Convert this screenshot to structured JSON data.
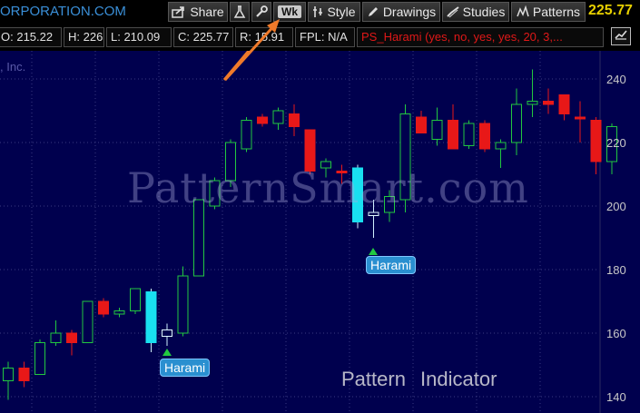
{
  "toolbar": {
    "corp_title": "ORPORATION.COM",
    "share_label": "Share",
    "wk_label": "Wk",
    "style_label": "Style",
    "drawings_label": "Drawings",
    "studies_label": "Studies",
    "patterns_label": "Patterns",
    "last_price": "225.77",
    "icons": [
      "share-icon",
      "flask-icon",
      "wrench-icon",
      "style-icon",
      "pencil-icon",
      "studies-icon",
      "patterns-icon"
    ]
  },
  "ohlc": {
    "open": "O: 215.22",
    "high": "H: 226",
    "low": "L: 210.09",
    "close": "C: 225.77",
    "range": "R: 15.91",
    "fpl": "FPL: N/A",
    "study": "PS_Harami (yes, no, yes, yes, 20, 3,..."
  },
  "chart": {
    "company_label": ", Inc.",
    "watermark": "PatternSmart.com",
    "pattern_indicator": "Pattern  Indicator",
    "annotations": [
      "Harami",
      "Harami"
    ],
    "colors": {
      "background": "#00004e",
      "up_candle": "#22c840",
      "down_candle": "#e81818",
      "harami_candle": "#19e0f0",
      "arrow_annotation": "#f07a2a"
    }
  },
  "chart_data": {
    "type": "candlestick",
    "y_axis_labels": [
      "240",
      "220",
      "200",
      "180",
      "160",
      "140"
    ],
    "ylim": [
      137,
      247
    ],
    "grid": true,
    "candles": [
      {
        "o": 145,
        "h": 151,
        "l": 139,
        "c": 149,
        "dir": "up"
      },
      {
        "o": 149,
        "h": 151,
        "l": 143,
        "c": 145,
        "dir": "down"
      },
      {
        "o": 147,
        "h": 158,
        "l": 147,
        "c": 157,
        "dir": "up"
      },
      {
        "o": 157,
        "h": 164,
        "l": 156,
        "c": 160,
        "dir": "up"
      },
      {
        "o": 160,
        "h": 161,
        "l": 153,
        "c": 157,
        "dir": "down"
      },
      {
        "o": 157,
        "h": 170,
        "l": 157,
        "c": 170,
        "dir": "up"
      },
      {
        "o": 170,
        "h": 171,
        "l": 165,
        "c": 166,
        "dir": "down"
      },
      {
        "o": 166,
        "h": 168,
        "l": 165,
        "c": 167,
        "dir": "up"
      },
      {
        "o": 167,
        "h": 174,
        "l": 166,
        "c": 174,
        "dir": "up"
      },
      {
        "o": 173,
        "h": 174,
        "l": 154,
        "c": 157,
        "dir": "harami1"
      },
      {
        "o": 159,
        "h": 163,
        "l": 156,
        "c": 161,
        "dir": "harami2"
      },
      {
        "o": 160,
        "h": 181,
        "l": 159,
        "c": 178,
        "dir": "up"
      },
      {
        "o": 178,
        "h": 202,
        "l": 178,
        "c": 202,
        "dir": "up"
      },
      {
        "o": 200,
        "h": 209,
        "l": 199,
        "c": 208,
        "dir": "up"
      },
      {
        "o": 208,
        "h": 221,
        "l": 206,
        "c": 220,
        "dir": "up"
      },
      {
        "o": 218,
        "h": 228,
        "l": 217,
        "c": 227,
        "dir": "up"
      },
      {
        "o": 228,
        "h": 229,
        "l": 225,
        "c": 226,
        "dir": "down"
      },
      {
        "o": 226,
        "h": 231,
        "l": 224,
        "c": 230,
        "dir": "up"
      },
      {
        "o": 229,
        "h": 232,
        "l": 222,
        "c": 225,
        "dir": "down"
      },
      {
        "o": 224,
        "h": 224,
        "l": 210,
        "c": 211,
        "dir": "down"
      },
      {
        "o": 212,
        "h": 215,
        "l": 209,
        "c": 214,
        "dir": "up"
      },
      {
        "o": 211,
        "h": 213,
        "l": 207,
        "c": 211,
        "dir": "down"
      },
      {
        "o": 212,
        "h": 213,
        "l": 193,
        "c": 195,
        "dir": "harami1"
      },
      {
        "o": 197,
        "h": 202,
        "l": 190,
        "c": 198,
        "dir": "harami2"
      },
      {
        "o": 198,
        "h": 205,
        "l": 195,
        "c": 203,
        "dir": "up"
      },
      {
        "o": 202,
        "h": 232,
        "l": 198,
        "c": 229,
        "dir": "up"
      },
      {
        "o": 228,
        "h": 230,
        "l": 223,
        "c": 223,
        "dir": "down"
      },
      {
        "o": 221,
        "h": 231,
        "l": 219,
        "c": 227,
        "dir": "up"
      },
      {
        "o": 227,
        "h": 232,
        "l": 218,
        "c": 218,
        "dir": "down"
      },
      {
        "o": 219,
        "h": 227,
        "l": 218,
        "c": 226,
        "dir": "up"
      },
      {
        "o": 226,
        "h": 227,
        "l": 217,
        "c": 218,
        "dir": "down"
      },
      {
        "o": 218,
        "h": 221,
        "l": 212,
        "c": 220,
        "dir": "up"
      },
      {
        "o": 220,
        "h": 237,
        "l": 216,
        "c": 232,
        "dir": "up"
      },
      {
        "o": 232,
        "h": 243,
        "l": 228,
        "c": 233,
        "dir": "up"
      },
      {
        "o": 233,
        "h": 237,
        "l": 229,
        "c": 232,
        "dir": "down"
      },
      {
        "o": 235,
        "h": 235,
        "l": 227,
        "c": 229,
        "dir": "down"
      },
      {
        "o": 228,
        "h": 233,
        "l": 220,
        "c": 228,
        "dir": "down"
      },
      {
        "o": 227,
        "h": 228,
        "l": 210,
        "c": 214,
        "dir": "down"
      },
      {
        "o": 214,
        "h": 226,
        "l": 210,
        "c": 225,
        "dir": "up"
      }
    ]
  }
}
